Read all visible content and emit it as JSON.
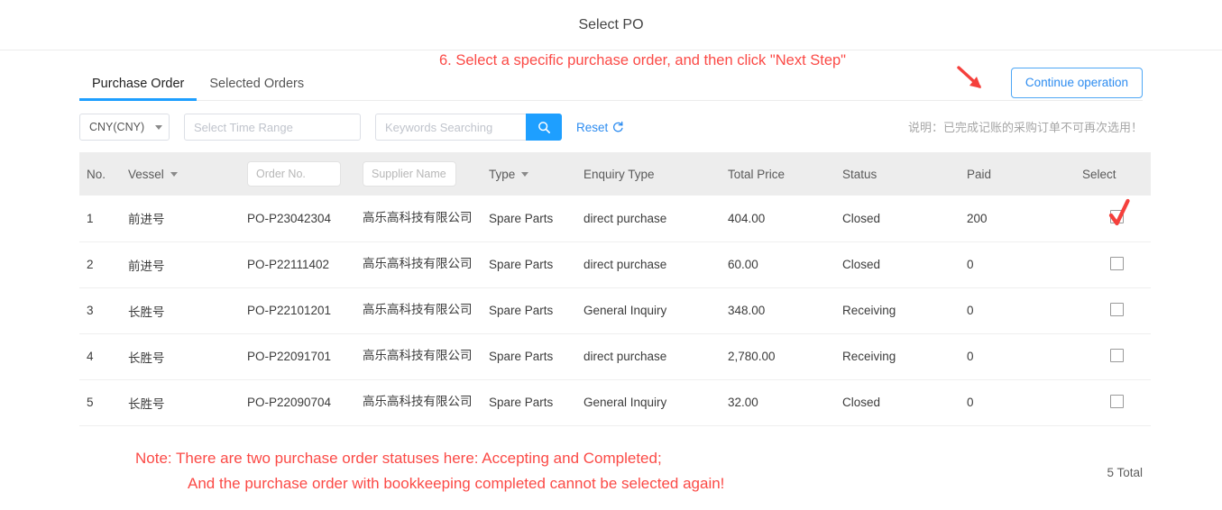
{
  "modal": {
    "title": "Select PO"
  },
  "annotations": {
    "step_text": "6. Select a specific purchase order, and then click \"Next Step\"",
    "arrow_icon": "red-arrow-icon",
    "note_line1": "Note: There are two purchase order statuses here: Accepting and Completed;",
    "note_line2": "And the purchase order with bookkeeping completed cannot be selected again!",
    "tick_icon": "red-checkmark-icon",
    "color": "#fb4a46"
  },
  "tabs": [
    {
      "label": "Purchase Order",
      "active": true
    },
    {
      "label": "Selected Orders",
      "active": false
    }
  ],
  "actions": {
    "continue_label": "Continue operation"
  },
  "filters": {
    "currency": {
      "value": "CNY(CNY)",
      "caret_icon": "caret-down-icon"
    },
    "time_range": {
      "placeholder": "Select Time Range",
      "value": ""
    },
    "keywords": {
      "placeholder": "Keywords Searching",
      "value": ""
    },
    "search_icon": "search-icon",
    "reset_label": "Reset",
    "reset_icon": "refresh-icon",
    "hint": "说明：已完成记账的采购订单不可再次选用！"
  },
  "table": {
    "columns": [
      {
        "key": "no",
        "label": "No."
      },
      {
        "key": "vessel",
        "label": "Vessel",
        "filter": "dropdown"
      },
      {
        "key": "order_no",
        "label": "",
        "filter": "input",
        "placeholder": "Order No."
      },
      {
        "key": "supplier",
        "label": "",
        "filter": "input",
        "placeholder": "Supplier Name"
      },
      {
        "key": "type",
        "label": "Type",
        "filter": "dropdown"
      },
      {
        "key": "enquiry_type",
        "label": "Enquiry Type"
      },
      {
        "key": "total_price",
        "label": "Total Price"
      },
      {
        "key": "status",
        "label": "Status"
      },
      {
        "key": "paid",
        "label": "Paid"
      },
      {
        "key": "select",
        "label": "Select"
      }
    ],
    "rows": [
      {
        "no": "1",
        "vessel": "前进号",
        "order_no": "PO-P23042304",
        "supplier": "高乐高科技有限公司",
        "type": "Spare Parts",
        "enquiry_type": "direct purchase",
        "total_price": "404.00",
        "status": "Closed",
        "paid": "200",
        "checked": false,
        "annotated_tick": true
      },
      {
        "no": "2",
        "vessel": "前进号",
        "order_no": "PO-P22111402",
        "supplier": "高乐高科技有限公司",
        "type": "Spare Parts",
        "enquiry_type": "direct purchase",
        "total_price": "60.00",
        "status": "Closed",
        "paid": "0",
        "checked": false,
        "annotated_tick": false
      },
      {
        "no": "3",
        "vessel": "长胜号",
        "order_no": "PO-P22101201",
        "supplier": "高乐高科技有限公司",
        "type": "Spare Parts",
        "enquiry_type": "General Inquiry",
        "total_price": "348.00",
        "status": "Receiving",
        "paid": "0",
        "checked": false,
        "annotated_tick": false
      },
      {
        "no": "4",
        "vessel": "长胜号",
        "order_no": "PO-P22091701",
        "supplier": "高乐高科技有限公司",
        "type": "Spare Parts",
        "enquiry_type": "direct purchase",
        "total_price": "2,780.00",
        "status": "Receiving",
        "paid": "0",
        "checked": false,
        "annotated_tick": false
      },
      {
        "no": "5",
        "vessel": "长胜号",
        "order_no": "PO-P22090704",
        "supplier": "高乐高科技有限公司",
        "type": "Spare Parts",
        "enquiry_type": "General Inquiry",
        "total_price": "32.00",
        "status": "Closed",
        "paid": "0",
        "checked": false,
        "annotated_tick": false
      }
    ]
  },
  "footer": {
    "total": "5 Total"
  },
  "colors": {
    "accent_blue": "#1e9fff",
    "link_blue": "#2d8cf0",
    "annotation_red": "#fb4a46",
    "header_grey": "#ededed"
  }
}
